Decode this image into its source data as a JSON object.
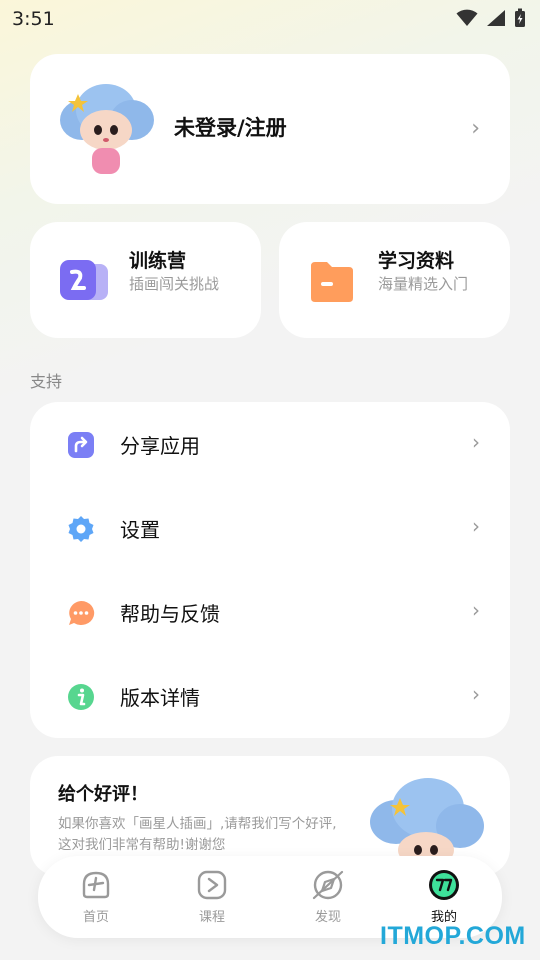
{
  "status_bar": {
    "time": "3:51"
  },
  "profile": {
    "login_label": "未登录/注册"
  },
  "features": [
    {
      "title": "训练营",
      "subtitle": "插画闯关挑战",
      "icon": "training-camp-icon",
      "color": "#7b6cf2"
    },
    {
      "title": "学习资料",
      "subtitle": "海量精选入门",
      "icon": "folder-icon",
      "color": "#ff9d5c"
    }
  ],
  "support": {
    "section_label": "支持",
    "items": [
      {
        "label": "分享应用",
        "icon": "share-icon",
        "color": "#7b7ff5"
      },
      {
        "label": "设置",
        "icon": "gear-icon",
        "color": "#5ea6f7"
      },
      {
        "label": "帮助与反馈",
        "icon": "chat-bubble-icon",
        "color": "#ff9a66"
      },
      {
        "label": "版本详情",
        "icon": "info-icon",
        "color": "#57d68f"
      }
    ]
  },
  "review": {
    "title": "给个好评！",
    "body": "如果你喜欢「画星人插画」,请帮我们写个好评,这对我们非常有帮助!谢谢您"
  },
  "tabs": [
    {
      "label": "首页",
      "icon": "home-icon",
      "active": false
    },
    {
      "label": "课程",
      "icon": "course-play-icon",
      "active": false
    },
    {
      "label": "发现",
      "icon": "discover-compass-icon",
      "active": false
    },
    {
      "label": "我的",
      "icon": "profile-icon",
      "active": true
    }
  ],
  "colors": {
    "accent_active": "#3ee09a",
    "background": "#f3f3f3"
  },
  "watermark": "ITMOP.COM"
}
